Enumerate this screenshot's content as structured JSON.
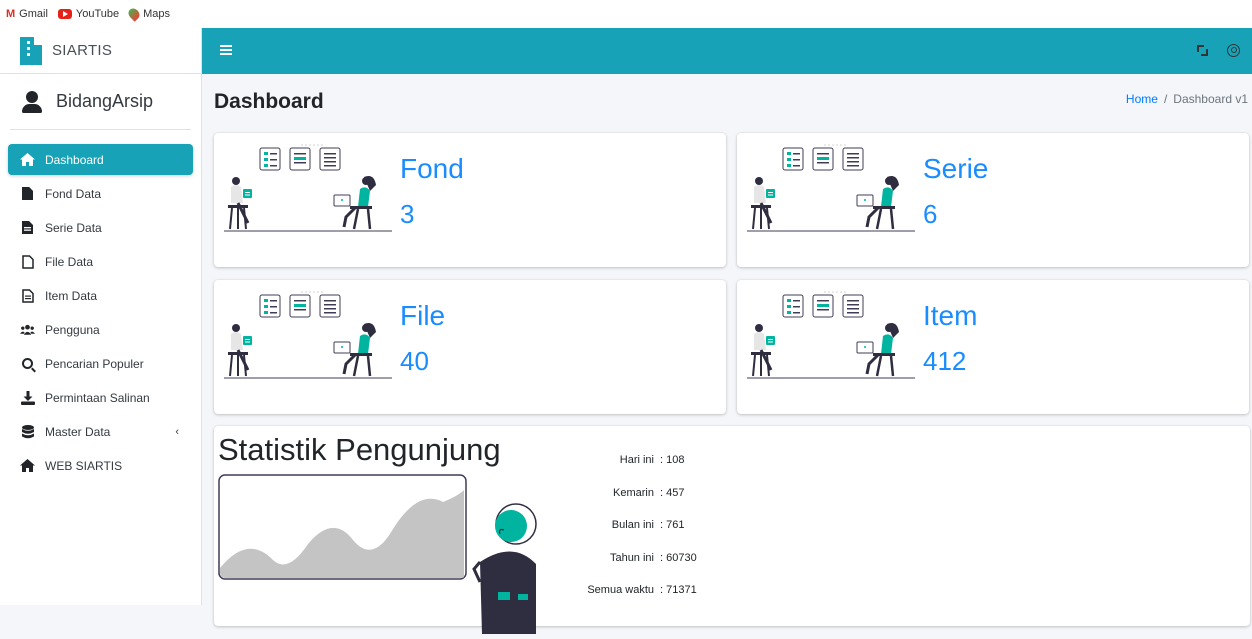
{
  "bookmarks": [
    {
      "label": "Gmail",
      "icon": "gmail-icon"
    },
    {
      "label": "YouTube",
      "icon": "youtube-icon"
    },
    {
      "label": "Maps",
      "icon": "maps-icon"
    }
  ],
  "brand": {
    "name": "SIARTIS"
  },
  "user": {
    "name": "BidangArsip"
  },
  "sidebar": {
    "items": [
      {
        "label": "Dashboard",
        "icon": "home-icon",
        "active": true
      },
      {
        "label": "Fond Data",
        "icon": "file-icon"
      },
      {
        "label": "Serie Data",
        "icon": "file-alt-icon"
      },
      {
        "label": "File Data",
        "icon": "file-outline-icon"
      },
      {
        "label": "Item Data",
        "icon": "file-lines-icon"
      },
      {
        "label": "Pengguna",
        "icon": "users-icon"
      },
      {
        "label": "Pencarian Populer",
        "icon": "search-icon"
      },
      {
        "label": "Permintaan Salinan",
        "icon": "download-icon"
      },
      {
        "label": "Master Data",
        "icon": "database-icon",
        "chevron": "‹"
      },
      {
        "label": "WEB SIARTIS",
        "icon": "home-icon"
      }
    ]
  },
  "header": {
    "title": "Dashboard",
    "breadcrumb": {
      "home": "Home",
      "separator": "/",
      "current": "Dashboard v1"
    }
  },
  "cards": [
    {
      "title": "Fond",
      "value": "3"
    },
    {
      "title": "Serie",
      "value": "6"
    },
    {
      "title": "File",
      "value": "40"
    },
    {
      "title": "Item",
      "value": "412"
    }
  ],
  "visitor_stats": {
    "title": "Statistik Pengunjung",
    "rows": [
      {
        "label": "Hari ini",
        "value": ": 108"
      },
      {
        "label": "Kemarin",
        "value": ": 457"
      },
      {
        "label": "Bulan ini",
        "value": ": 761"
      },
      {
        "label": "Tahun ini",
        "value": ": 60730"
      },
      {
        "label": "Semua waktu",
        "value": ": 71371"
      }
    ]
  },
  "colors": {
    "accent": "#17a2b8",
    "value_blue": "#1a8cff",
    "illustration_teal": "#00b4a0"
  }
}
